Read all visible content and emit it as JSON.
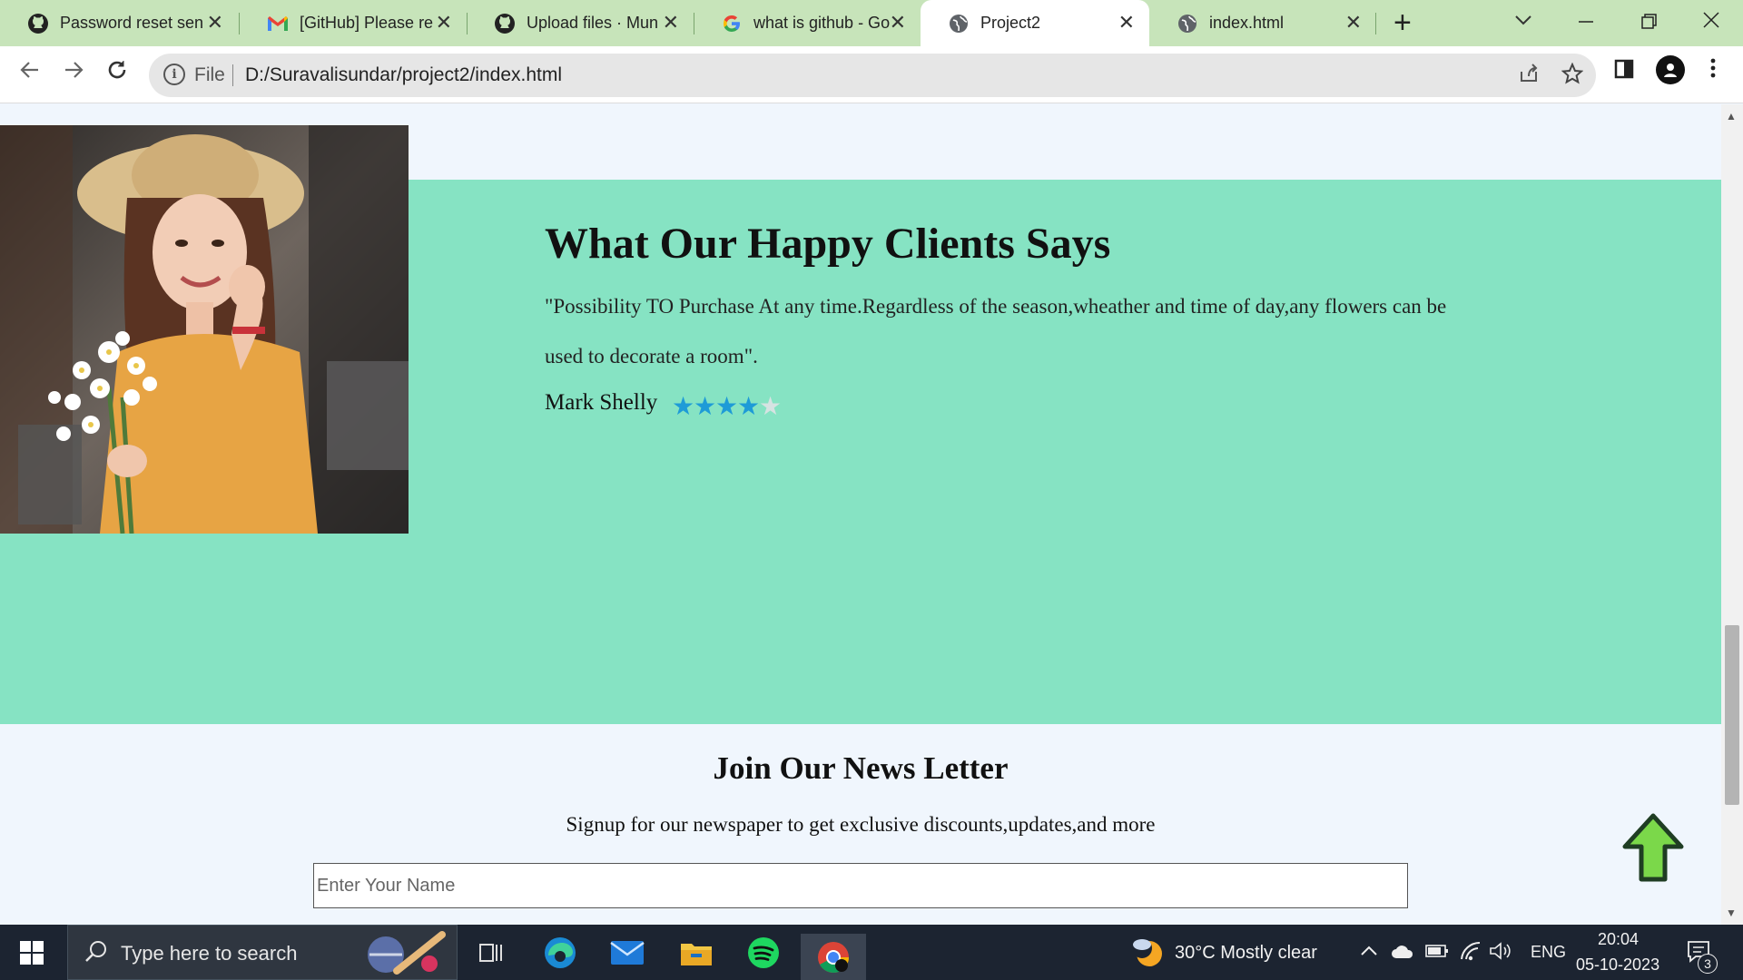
{
  "browser": {
    "tabs": [
      {
        "title": "Password reset sen",
        "icon": "github-icon"
      },
      {
        "title": "[GitHub] Please re",
        "icon": "gmail-icon"
      },
      {
        "title": "Upload files · Mun",
        "icon": "github-icon"
      },
      {
        "title": "what is github - Go",
        "icon": "google-icon"
      },
      {
        "title": "Project2",
        "icon": "globe-icon",
        "active": true
      },
      {
        "title": "index.html",
        "icon": "globe-icon"
      }
    ],
    "address": {
      "scheme_label": "File",
      "url": "D:/Suravalisundar/project2/index.html"
    }
  },
  "page": {
    "testimonial": {
      "heading": "What Our Happy Clients Says",
      "quote": "\"Possibility TO Purchase At any time.Regardless of the season,wheather and time of day,any flowers can be used to decorate a room\".",
      "author": "Mark Shelly",
      "rating": 4,
      "rating_max": 5,
      "star_on_color": "#1e9bd7",
      "band_color": "#86e3c3"
    },
    "newsletter": {
      "title": "Join Our News Letter",
      "subtitle": "Signup for our newspaper to get exclusive discounts,updates,and more",
      "name_placeholder": "Enter Your Name"
    }
  },
  "taskbar": {
    "search_placeholder": "Type here to search",
    "weather": "30°C  Mostly clear",
    "language": "ENG",
    "time": "20:04",
    "date": "05-10-2023",
    "notification_count": "3"
  }
}
